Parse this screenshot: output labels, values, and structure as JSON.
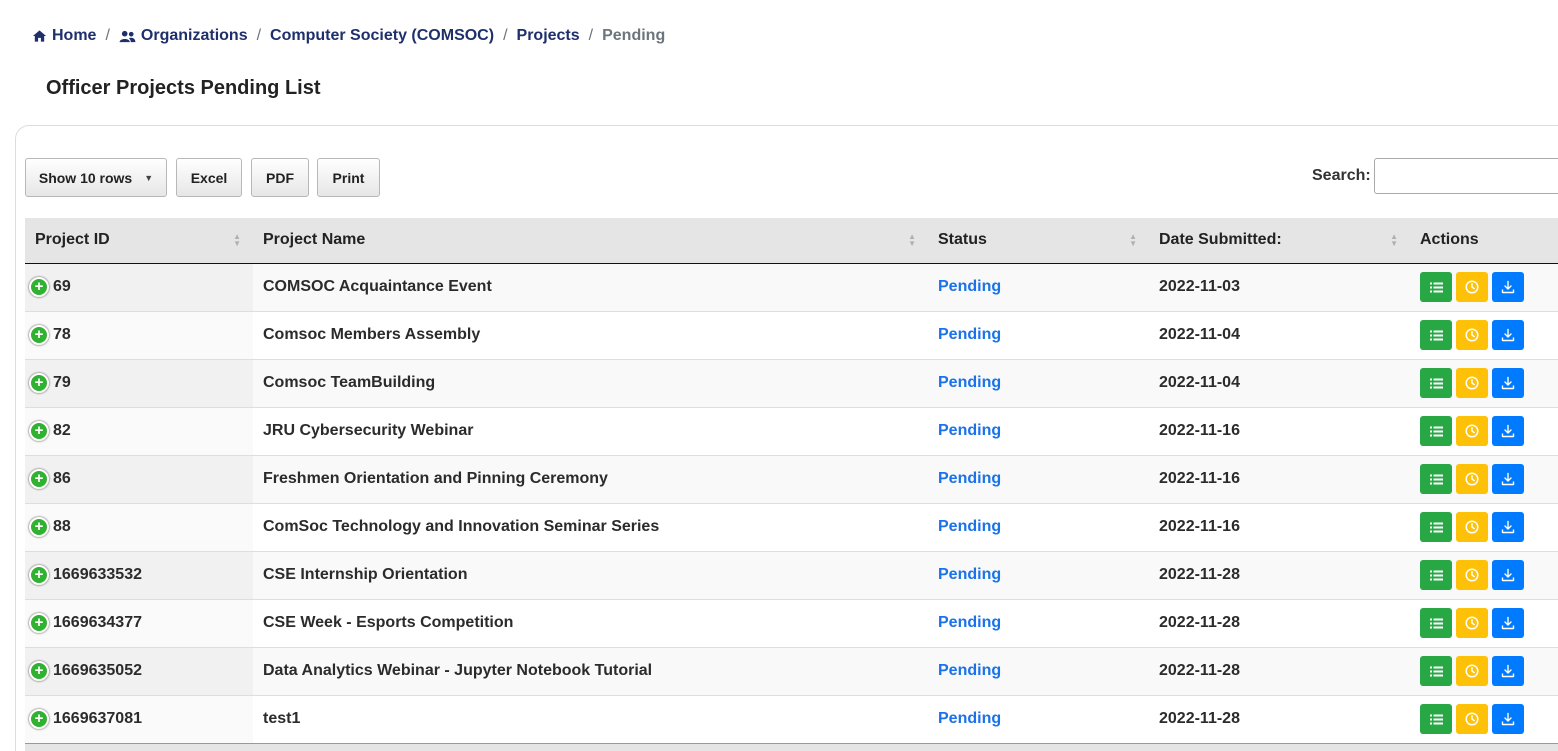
{
  "breadcrumb": {
    "home": "Home",
    "organizations": "Organizations",
    "org": "Computer Society (COMSOC)",
    "projects": "Projects",
    "current": "Pending",
    "separator": "/"
  },
  "page_title": "Officer Projects Pending List",
  "toolbar": {
    "rows_label": "Show 10 rows",
    "excel_label": "Excel",
    "pdf_label": "PDF",
    "print_label": "Print",
    "search_label": "Search:",
    "search_value": ""
  },
  "table": {
    "columns": [
      "Project ID",
      "Project Name",
      "Status",
      "Date Submitted:",
      "Actions"
    ],
    "rows": [
      {
        "id": "69",
        "name": "COMSOC Acquaintance Event",
        "status": "Pending",
        "date": "2022-11-03"
      },
      {
        "id": "78",
        "name": "Comsoc Members Assembly",
        "status": "Pending",
        "date": "2022-11-04"
      },
      {
        "id": "79",
        "name": "Comsoc TeamBuilding",
        "status": "Pending",
        "date": "2022-11-04"
      },
      {
        "id": "82",
        "name": "JRU Cybersecurity Webinar",
        "status": "Pending",
        "date": "2022-11-16"
      },
      {
        "id": "86",
        "name": "Freshmen Orientation and Pinning Ceremony",
        "status": "Pending",
        "date": "2022-11-16"
      },
      {
        "id": "88",
        "name": "ComSoc Technology and Innovation Seminar Series",
        "status": "Pending",
        "date": "2022-11-16"
      },
      {
        "id": "1669633532",
        "name": "CSE Internship Orientation",
        "status": "Pending",
        "date": "2022-11-28"
      },
      {
        "id": "1669634377",
        "name": "CSE Week - Esports Competition",
        "status": "Pending",
        "date": "2022-11-28"
      },
      {
        "id": "1669635052",
        "name": "Data Analytics Webinar - Jupyter Notebook Tutorial",
        "status": "Pending",
        "date": "2022-11-28"
      },
      {
        "id": "1669637081",
        "name": "test1",
        "status": "Pending",
        "date": "2022-11-28"
      }
    ]
  },
  "colors": {
    "breadcrumb_link": "#1f2f6b",
    "status_link": "#1a73e8",
    "action_view": "#28a745",
    "action_history": "#ffc107",
    "action_download": "#007bff",
    "expand_icon": "#31b131"
  },
  "icons": {
    "home": "home-icon",
    "organizations": "users-icon",
    "expand": "plus-circle-icon",
    "view": "list-icon",
    "history": "clock-icon",
    "download": "download-icon",
    "sort": "sort-icon"
  }
}
